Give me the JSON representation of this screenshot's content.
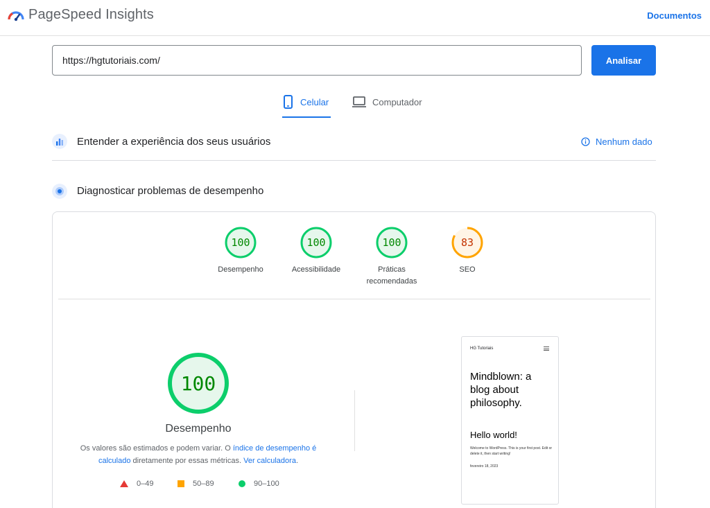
{
  "header": {
    "brand": "PageSpeed Insights",
    "docs_link": "Documentos",
    "logo_icon": "pagespeed-logo-icon"
  },
  "form": {
    "url_value": "https://hgtutoriais.com/",
    "analyze_label": "Analisar"
  },
  "tabs": [
    {
      "label": "Celular",
      "icon": "smartphone-icon",
      "active": true
    },
    {
      "label": "Computador",
      "icon": "laptop-icon",
      "active": false
    }
  ],
  "field_section": {
    "title": "Entender a experiência dos seus usuários",
    "no_data": "Nenhum dado"
  },
  "lab_section": {
    "title": "Diagnosticar problemas de desempenho"
  },
  "scores": [
    {
      "label": "Desempenho",
      "value": "100",
      "fraction": 1.0
    },
    {
      "label": "Acessibilidade",
      "value": "100",
      "fraction": 1.0
    },
    {
      "label": "Práticas recomendadas",
      "value": "100",
      "fraction": 1.0
    },
    {
      "label": "SEO",
      "value": "83",
      "fraction": 0.83
    }
  ],
  "performance": {
    "score": "100",
    "fraction": 1.0,
    "label": "Desempenho",
    "note_prefix": "Os valores são estimados e podem variar. O ",
    "note_link1": "índice de desempenho é calculado",
    "note_middle": " diretamente por essas métricas. ",
    "note_link2": "Ver calculadora",
    "note_suffix": "."
  },
  "legend": [
    {
      "range": "0–49",
      "shape": "triangle",
      "color": "#e53935"
    },
    {
      "range": "50–89",
      "shape": "square",
      "color": "#ffa400"
    },
    {
      "range": "90–100",
      "shape": "circle",
      "color": "#0cce6b"
    }
  ],
  "preview": {
    "site_name": "HG Tutoriais",
    "headline": "Mindblown: a blog about philosophy.",
    "post_title": "Hello world!",
    "post_excerpt": "Welcome to WordPress. This is your first post. Edit or delete it, then start writing!",
    "post_date": "fevereiro 18, 2023"
  },
  "colors": {
    "accent": "#1a73e8",
    "good": "#0cce6b",
    "good_text": "#008800",
    "average": "#ffa400",
    "average_text": "#c33300"
  }
}
